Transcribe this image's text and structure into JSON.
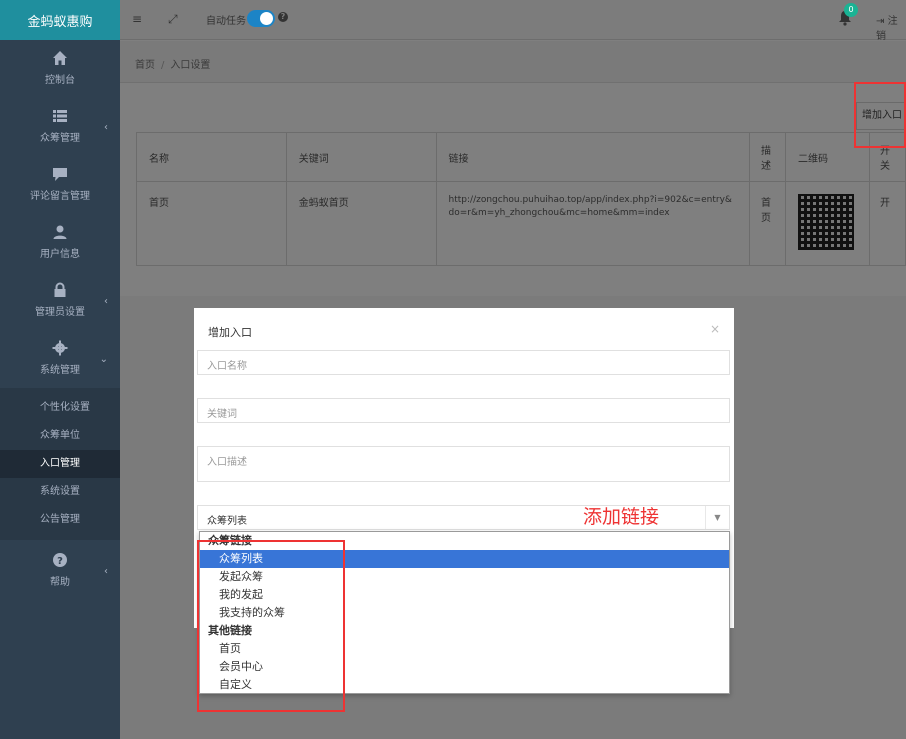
{
  "sidebar": {
    "brand": "金蚂蚁惠购",
    "items": [
      {
        "label": "控制台"
      },
      {
        "label": "众筹管理"
      },
      {
        "label": "评论留言管理"
      },
      {
        "label": "用户信息"
      },
      {
        "label": "管理员设置"
      },
      {
        "label": "系统管理"
      }
    ],
    "sub_items": [
      {
        "label": "个性化设置"
      },
      {
        "label": "众筹单位"
      },
      {
        "label": "入口管理"
      },
      {
        "label": "系统设置"
      },
      {
        "label": "公告管理"
      }
    ],
    "help": "帮助"
  },
  "topbar": {
    "auto_task_label": "自动任务",
    "notification_count": "0",
    "logout_label": "注销",
    "help_glyph": "?"
  },
  "breadcrumb": {
    "home": "首页",
    "sep": "/",
    "current": "入口设置"
  },
  "toolbar": {
    "add_label": "增加入口"
  },
  "table": {
    "headers": [
      "名称",
      "关键词",
      "链接",
      "描述",
      "二维码",
      "开关"
    ],
    "rows": [
      {
        "name": "首页",
        "keyword": "金蚂蚁首页",
        "link": "http://zongchou.puhuihao.top/app/index.php?i=902&c=entry&do=r&m=yh_zhongchou&mc=home&mm=index",
        "desc": "首页",
        "toggle": "开"
      }
    ]
  },
  "modal": {
    "title": "增加入口",
    "close_glyph": "×",
    "name_placeholder": "入口名称",
    "keyword_placeholder": "关键词",
    "desc_placeholder": "入口描述",
    "select_value": "众筹列表"
  },
  "dropdown": {
    "groups": [
      {
        "label": "众筹链接",
        "options": [
          "众筹列表",
          "发起众筹",
          "我的发起",
          "我支持的众筹"
        ]
      },
      {
        "label": "其他链接",
        "options": [
          "首页",
          "会员中心",
          "自定义"
        ]
      }
    ],
    "selected": "众筹列表"
  },
  "annotation": "添加链接",
  "colors": {
    "sidebar": "#2f4050",
    "brand": "#1f8f9e",
    "accent": "#1c84c6",
    "highlight": "#e33333",
    "selected_option": "#3875d7"
  }
}
